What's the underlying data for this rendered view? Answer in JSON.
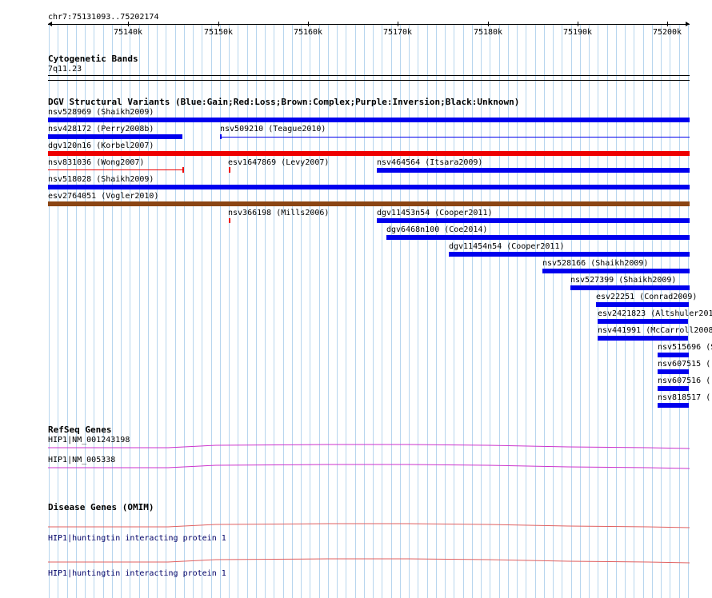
{
  "ruler": {
    "position": "chr7:75131093..75202174",
    "ticks": [
      "75140k",
      "75150k",
      "75160k",
      "75170k",
      "75180k",
      "75190k",
      "75200k"
    ]
  },
  "tracks": {
    "cytoband": {
      "title": "Cytogenetic Bands",
      "band": "7q11.23"
    },
    "dgv": {
      "title": "DGV Structural Variants (Blue:Gain;Red:Loss;Brown:Complex;Purple:Inversion;Black:Unknown)",
      "colors": {
        "gain": "#0000ee",
        "loss": "#ee0000",
        "complex": "#8b4513"
      },
      "variants": [
        "nsv528969 (Shaikh2009)",
        "nsv428172 (Perry2008b)",
        "nsv509210 (Teague2010)",
        "dgv120n16 (Korbel2007)",
        "nsv831036 (Wong2007)",
        "esv1647869 (Levy2007)",
        "nsv464564 (Itsara2009)",
        "nsv518028 (Shaikh2009)",
        "esv2764051 (Vogler2010)",
        "nsv366198 (Mills2006)",
        "dgv11453n54 (Cooper2011)",
        "dgv6468n100 (Coe2014)",
        "dgv11454n54 (Cooper2011)",
        "nsv528166 (Shaikh2009)",
        "nsv527399 (Shaikh2009)",
        "esv22251 (Conrad2009)",
        "esv2421823 (Altshuler201",
        "nsv441991 (McCarroll2008",
        "nsv515696 (S",
        "nsv607515 (",
        "nsv607516 (",
        "nsv818517 ("
      ]
    },
    "refseq": {
      "title": "RefSeq Genes",
      "genes": [
        "HIP1|NM_001243198",
        "HIP1|NM_005338"
      ],
      "color": "#cc33cc"
    },
    "omim": {
      "title": "Disease Genes (OMIM)",
      "genes": [
        "HIP1|huntingtin interacting protein 1",
        "HIP1|huntingtin interacting protein 1"
      ],
      "color": "#e06060"
    }
  }
}
